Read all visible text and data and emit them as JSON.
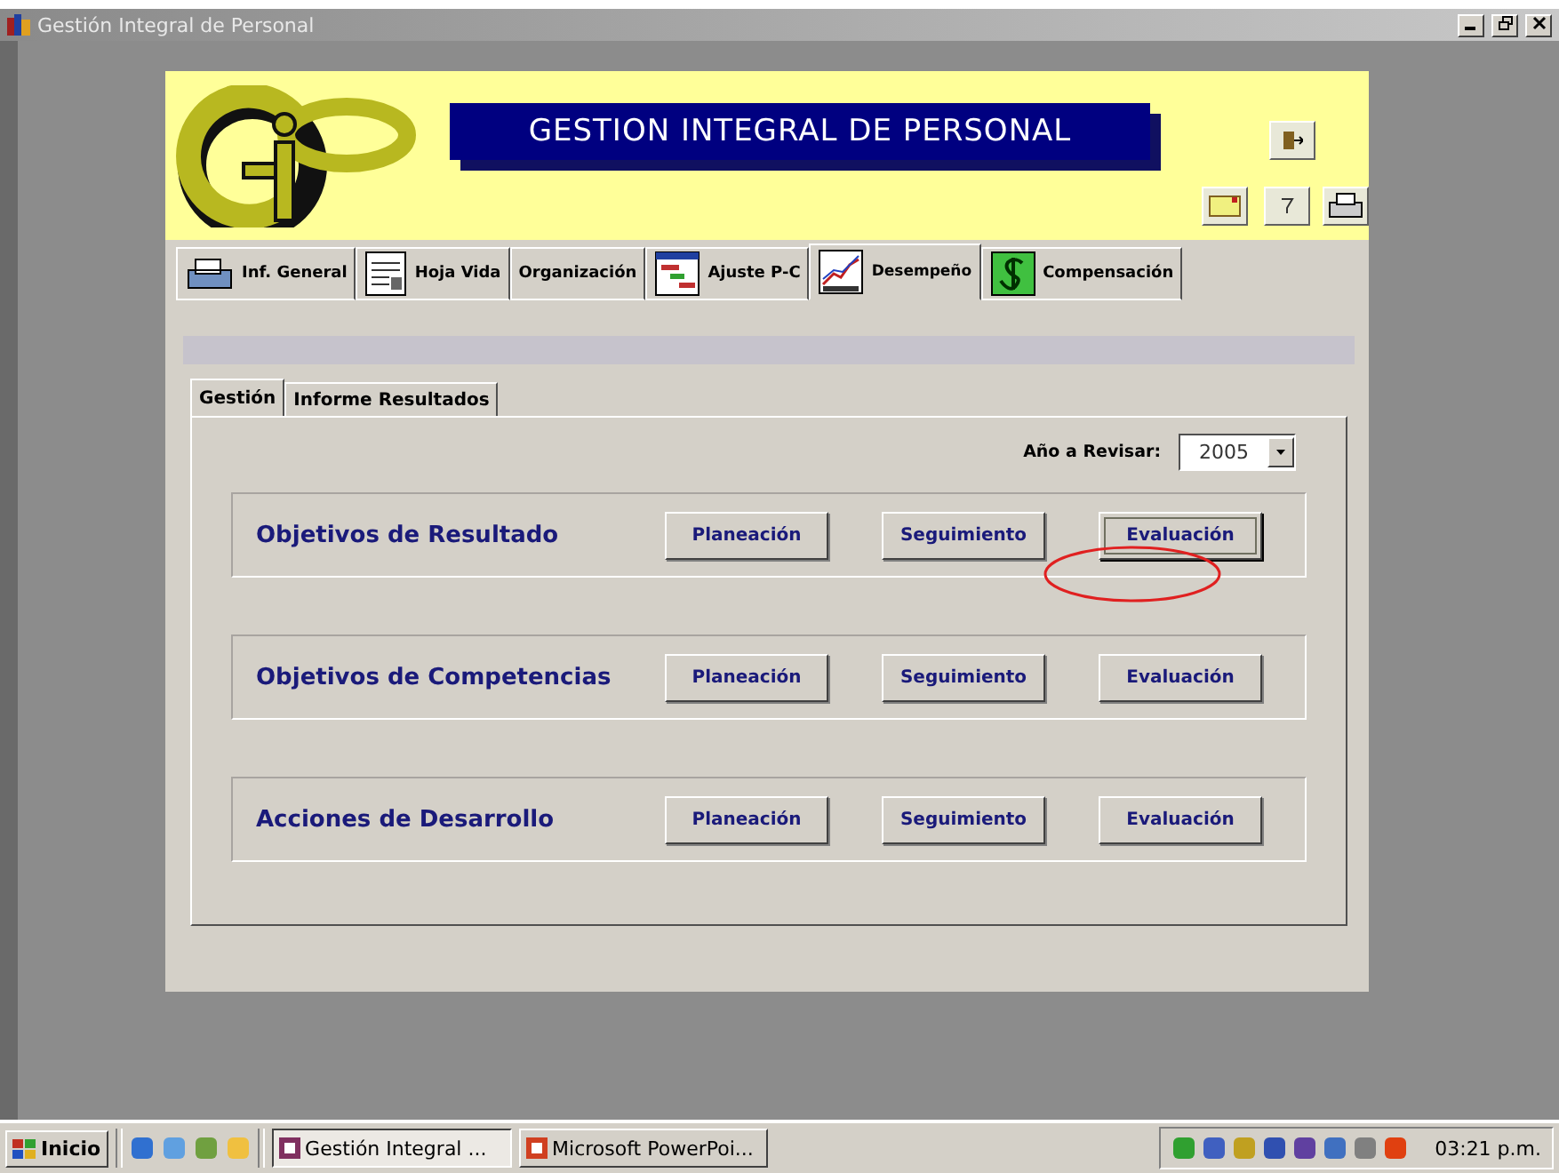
{
  "window": {
    "title": "Gestión Integral de Personal"
  },
  "header": {
    "title": "GESTION INTEGRAL DE PERSONAL"
  },
  "main_tabs": [
    {
      "label": "Inf. General",
      "selected": false,
      "kind": "printer"
    },
    {
      "label": "Hoja Vida",
      "selected": false,
      "kind": "form"
    },
    {
      "label": "Organización",
      "selected": false,
      "kind": "none"
    },
    {
      "label": "Ajuste P-C",
      "selected": false,
      "kind": "grid"
    },
    {
      "label": "Desempeño",
      "selected": true,
      "kind": "chart"
    },
    {
      "label": "Compensación",
      "selected": false,
      "kind": "money"
    }
  ],
  "sub_tabs": [
    {
      "label": "Gestión",
      "selected": true
    },
    {
      "label": "Informe Resultados",
      "selected": false
    }
  ],
  "year": {
    "label": "Año a Revisar:",
    "value": "2005"
  },
  "sections": [
    {
      "title": "Objetivos de Resultado",
      "buttons": [
        {
          "label": "Planeación",
          "focused": false
        },
        {
          "label": "Seguimiento",
          "focused": false
        },
        {
          "label": "Evaluación",
          "focused": true
        }
      ]
    },
    {
      "title": "Objetivos de Competencias",
      "buttons": [
        {
          "label": "Planeación",
          "focused": false
        },
        {
          "label": "Seguimiento",
          "focused": false
        },
        {
          "label": "Evaluación",
          "focused": false
        }
      ]
    },
    {
      "title": "Acciones de Desarrollo",
      "buttons": [
        {
          "label": "Planeación",
          "focused": false
        },
        {
          "label": "Seguimiento",
          "focused": false
        },
        {
          "label": "Evaluación",
          "focused": false
        }
      ]
    }
  ],
  "taskbar": {
    "start": "Inicio",
    "tasks": [
      {
        "label": "Gestión Integral ...",
        "selected": true
      },
      {
        "label": "Microsoft PowerPoi...",
        "selected": false
      }
    ],
    "clock": "03:21 p.m."
  }
}
